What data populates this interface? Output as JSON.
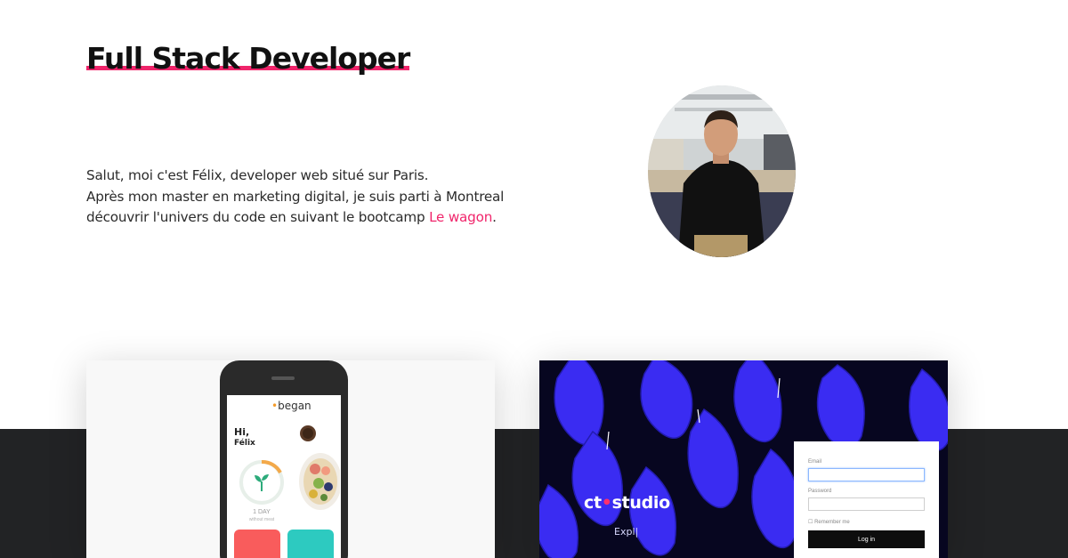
{
  "header": {
    "title": "Full Stack Developer"
  },
  "intro": {
    "line1": "Salut, moi c'est Félix, developer web situé sur Paris.",
    "line2": "Après mon master en marketing digital, je suis parti à Montreal",
    "line3_prefix": "découvrir l'univers du code en suivant le bootcamp ",
    "link": "Le wagon",
    "line3_suffix": "."
  },
  "projects": [
    {
      "app_brand": "began",
      "greeting": "Hi,",
      "user_name": "Félix",
      "day_count": "1 DAY",
      "day_caption": "without meat"
    },
    {
      "brand_prefix": "ct",
      "brand_suffix": "studio",
      "subtitle": "Expl|",
      "login": {
        "email_label": "Email",
        "password_label": "Password",
        "remember_label": "Remember me",
        "login_button": "Log in"
      }
    }
  ],
  "colors": {
    "accent": "#f0256b",
    "dark_band": "#222325",
    "began_red": "#f95c5c",
    "began_teal": "#2dcac0",
    "ct_blue": "#3a2cf2"
  }
}
